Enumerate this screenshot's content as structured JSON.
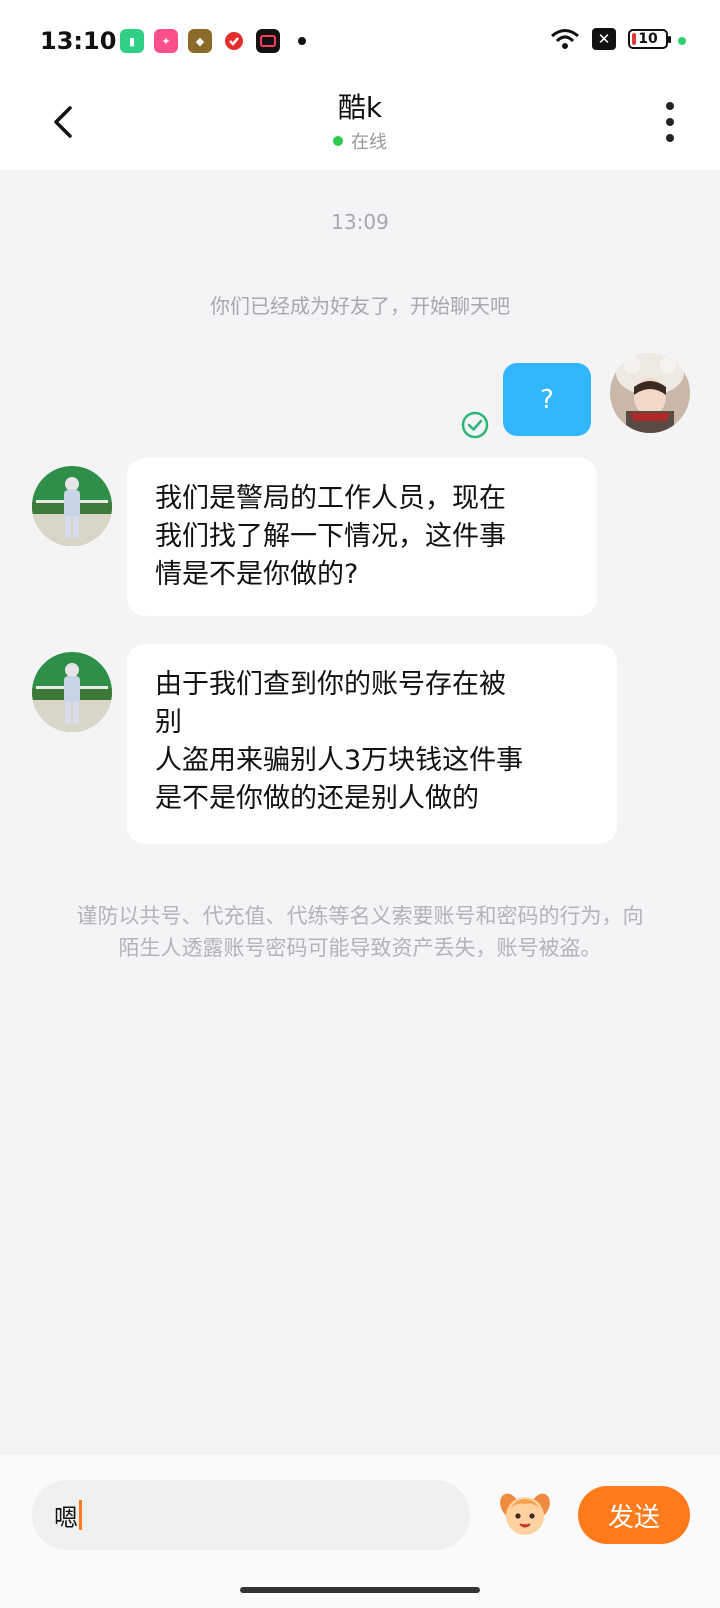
{
  "status_bar": {
    "time": "13:10",
    "battery": "10",
    "app_icons": [
      "battery-app-icon",
      "pink-app-icon",
      "game-app-icon",
      "red-app-icon",
      "video-app-icon"
    ]
  },
  "header": {
    "title": "酷k",
    "status": "在线"
  },
  "chat": {
    "timestamp": "13:09",
    "system_message": "你们已经成为好友了，开始聊天吧",
    "my_message": "?",
    "messages": [
      {
        "lines": [
          "我们是警局的工作人员，现在",
          "我们找了解一下情况，这件事",
          "情是不是你做的?"
        ]
      },
      {
        "lines": [
          "由于我们查到你的账号存在被",
          "别",
          "人盗用来骗别人3万块钱这件事",
          "是不是你做的还是别人做的"
        ]
      }
    ],
    "warning": "谨防以共号、代充值、代练等名义索要账号和密码的行为，向陌生人透露账号密码可能导致资产丢失，账号被盗。"
  },
  "input": {
    "value": "嗯",
    "send_label": "发送"
  },
  "colors": {
    "accent": "#ff7a1a",
    "my_bubble": "#32b7ff",
    "online": "#2cc84d",
    "read_check": "#2bb673"
  }
}
